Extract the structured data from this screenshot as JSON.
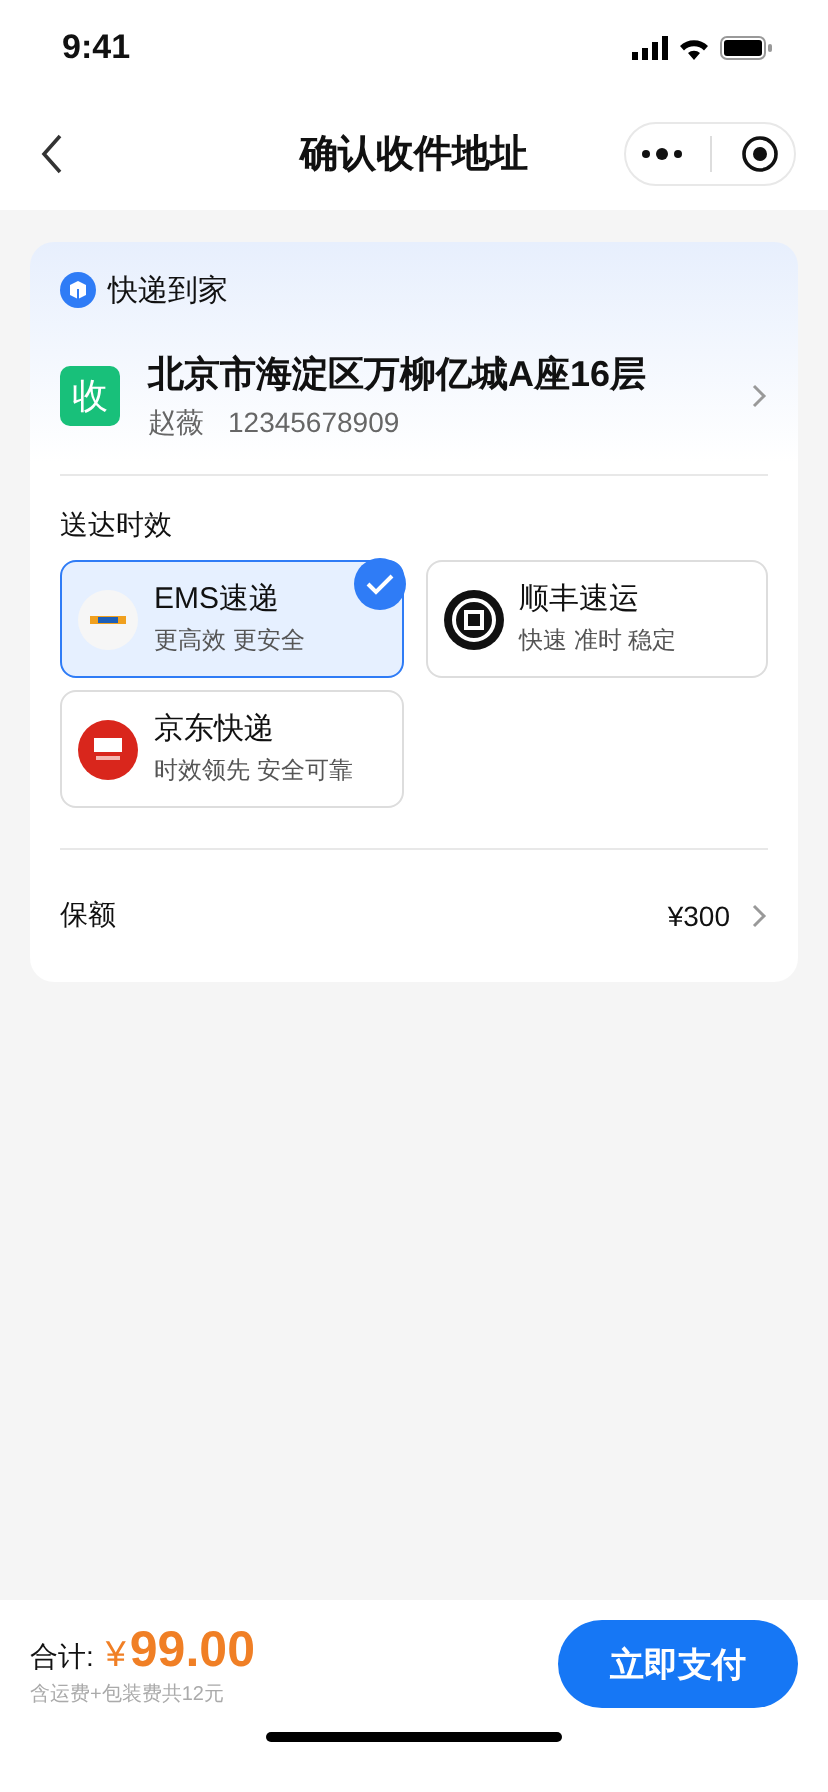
{
  "status_bar": {
    "time": "9:41"
  },
  "nav": {
    "title": "确认收件地址"
  },
  "card": {
    "header": "快递到家",
    "address": {
      "badge": "收",
      "line": "北京市海淀区万柳亿城A座16层",
      "name": "赵薇",
      "phone": "12345678909"
    },
    "section_title": "送达时效",
    "carriers": [
      {
        "kind": "ems",
        "name": "EMS速递",
        "desc": "更高效 更安全",
        "selected": true
      },
      {
        "kind": "sf",
        "name": "顺丰速运",
        "desc": "快速 准时 稳定",
        "selected": false
      },
      {
        "kind": "jd",
        "name": "京东快递",
        "desc": "时效领先 安全可靠",
        "selected": false
      }
    ],
    "insurance": {
      "label": "保额",
      "value": "¥300"
    }
  },
  "footer": {
    "total_label": "合计:",
    "currency": "¥",
    "amount": "99.00",
    "note": "含运费+包装费共12元",
    "pay_button": "立即支付"
  }
}
